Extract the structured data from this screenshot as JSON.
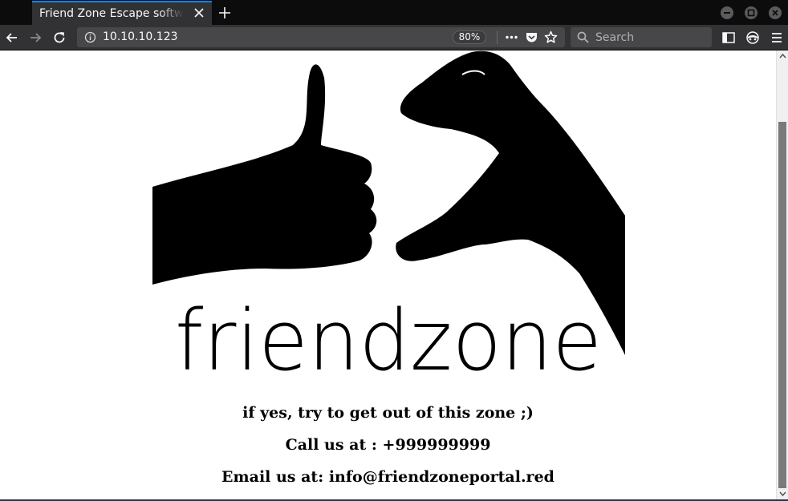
{
  "browser": {
    "tab_title": "Friend Zone Escape software",
    "url": "10.10.10.123",
    "zoom": "80%",
    "search_placeholder": "Search"
  },
  "page": {
    "logo_text": "friendzone",
    "lines": [
      "if yes, try to get out of this zone ;)",
      "Call us at : +999999999",
      "Email us at: info@friendzoneportal.red"
    ]
  },
  "icons": {
    "tab_close": "close-icon",
    "new_tab": "plus-icon",
    "back": "back-arrow-icon",
    "forward": "forward-arrow-icon",
    "reload": "reload-icon",
    "page_info": "info-icon",
    "page_actions": "ellipsis-icon",
    "pocket": "pocket-icon",
    "bookmark": "star-icon",
    "search": "search-icon",
    "reader": "sidebar-icon",
    "addon": "mask-icon",
    "menu": "hamburger-icon"
  },
  "colors": {
    "accent": "#0a84ff",
    "chrome_dark": "#0c0c0d",
    "chrome": "#323234",
    "field": "#474749"
  }
}
